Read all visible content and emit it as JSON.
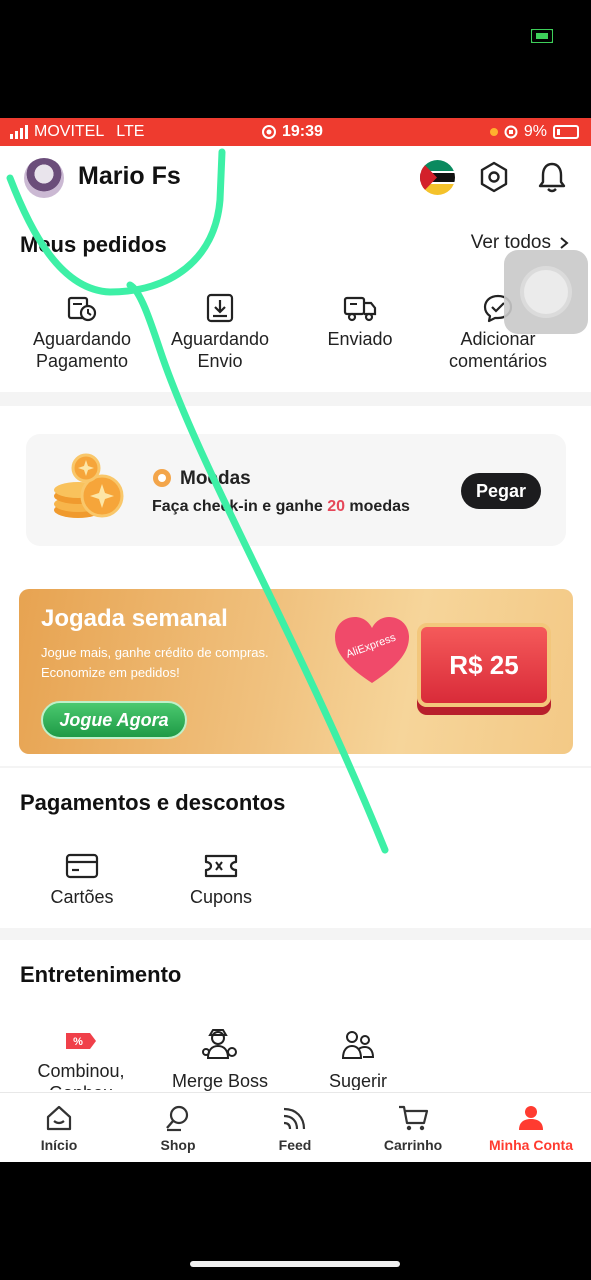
{
  "status_bar": {
    "carrier": "MOVITEL",
    "network": "LTE",
    "time": "19:39",
    "battery": "9%"
  },
  "header": {
    "username": "Mario Fs"
  },
  "orders": {
    "title": "Meus pedidos",
    "see_all": "Ver todos",
    "items": [
      {
        "label": "Aguardando Pagamento",
        "icon": "pending-payment-icon"
      },
      {
        "label": "Aguardando Envio",
        "icon": "pending-shipment-icon"
      },
      {
        "label": "Enviado",
        "icon": "shipped-truck-icon"
      },
      {
        "label": "Adicionar comentários",
        "icon": "review-chat-icon"
      }
    ]
  },
  "coins": {
    "title": "Moedas",
    "subtitle_pre": "Faça check-in e ganhe ",
    "subtitle_num": "20",
    "subtitle_post": " moedas",
    "button": "Pegar"
  },
  "banner": {
    "title": "Jogada semanal",
    "subtitle": "Jogue mais, ganhe crédito de compras. Economize em pedidos!",
    "button": "Jogue Agora",
    "heart_text": "AliExpress",
    "ticket": "R$ 25"
  },
  "payments": {
    "title": "Pagamentos e descontos",
    "items": [
      {
        "label": "Cartões",
        "icon": "card-icon"
      },
      {
        "label": "Cupons",
        "icon": "coupon-icon"
      }
    ]
  },
  "entertainment": {
    "title": "Entretenimento",
    "items": [
      {
        "label": "Combinou, Ganhou",
        "icon": "discount-tag-icon"
      },
      {
        "label": "Merge Boss",
        "icon": "merge-boss-icon"
      },
      {
        "label": "Sugerir amigos",
        "icon": "friends-icon"
      }
    ]
  },
  "tabbar": {
    "items": [
      {
        "label": "Início",
        "icon": "home-icon"
      },
      {
        "label": "Shop",
        "icon": "search-icon"
      },
      {
        "label": "Feed",
        "icon": "feed-icon"
      },
      {
        "label": "Carrinho",
        "icon": "cart-icon"
      },
      {
        "label": "Minha Conta",
        "icon": "account-icon"
      }
    ],
    "active_index": 4
  },
  "colors": {
    "accent": "#ee3b2f",
    "active_tab": "#ff3b30",
    "highlight_number": "#e5475a",
    "scribble": "#3df0a6"
  }
}
